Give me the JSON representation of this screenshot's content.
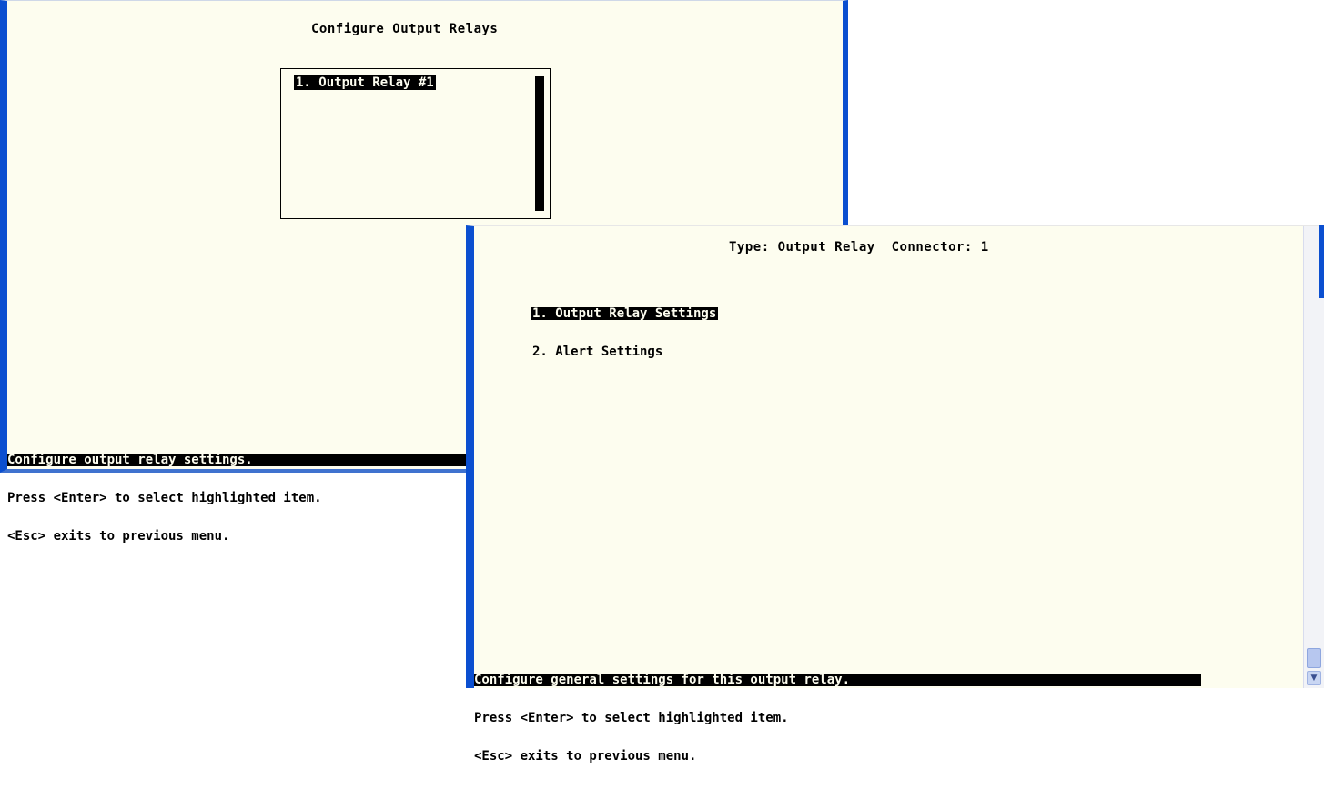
{
  "left_window": {
    "title": "Configure Output Relays",
    "list_items": [
      "1. Output Relay #1"
    ],
    "status_lines": [
      "Configure output relay settings.",
      "Press <Enter> to select highlighted item.",
      "<Esc> exits to previous menu."
    ]
  },
  "right_window": {
    "title": "Type: Output Relay  Connector: 1",
    "menu_items": [
      "1. Output Relay Settings",
      "2. Alert Settings"
    ],
    "status_lines": [
      "Configure general settings for this output relay.",
      "Press <Enter> to select highlighted item.",
      "<Esc> exits to previous menu."
    ],
    "scroll_down_icon": "chevron-down-icon"
  },
  "colors": {
    "terminal_bg": "#fdfdef",
    "window_border": "#0b4fd0",
    "highlight": "#000000"
  }
}
